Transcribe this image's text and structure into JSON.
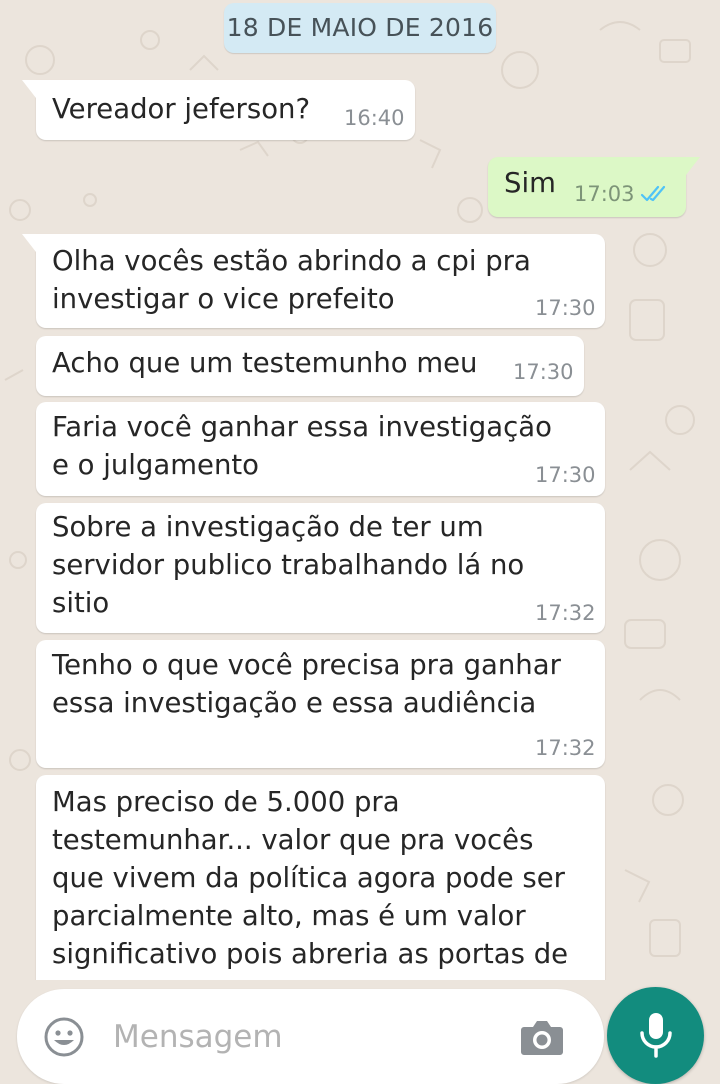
{
  "chat": {
    "date_separator": "18 DE MAIO DE 2016",
    "messages": [
      {
        "direction": "incoming",
        "lines": [
          "Vereador jeferson?"
        ],
        "time": "16:40"
      },
      {
        "direction": "outgoing",
        "lines": [
          "Sim"
        ],
        "time": "17:03",
        "status": "read"
      },
      {
        "direction": "incoming",
        "lines": [
          "Olha vocês estão abrindo a cpi pra",
          "investigar o vice prefeito"
        ],
        "time": "17:30"
      },
      {
        "direction": "incoming",
        "lines": [
          "Acho que um testemunho meu"
        ],
        "time": "17:30"
      },
      {
        "direction": "incoming",
        "lines": [
          "Faria você ganhar essa investigação",
          "e o julgamento"
        ],
        "time": "17:30"
      },
      {
        "direction": "incoming",
        "lines": [
          "Sobre a investigação de ter um",
          "servidor publico trabalhando lá no",
          "sitio"
        ],
        "time": "17:32"
      },
      {
        "direction": "incoming",
        "lines": [
          "Tenho o que você precisa pra ganhar",
          "essa investigação e essa audiência"
        ],
        "time": "17:32"
      },
      {
        "direction": "incoming",
        "lines": [
          "Mas preciso de 5.000 pra",
          "testemunhar... valor que pra vocês",
          "que vivem da política agora pode ser",
          "parcialmente alto, mas é um valor",
          "significativo pois abreria as portas de"
        ],
        "time": ""
      }
    ]
  },
  "composer": {
    "placeholder": "Mensagem",
    "emoji_icon": "emoji-icon",
    "camera_icon": "camera-icon",
    "mic_icon": "microphone-icon"
  },
  "colors": {
    "background": "#ECE5DD",
    "incoming_bubble": "#FFFFFF",
    "outgoing_bubble": "#DCF8C6",
    "date_chip": "#D4EAF4",
    "read_ticks": "#4FC3F7",
    "accent": "#128C7E"
  }
}
